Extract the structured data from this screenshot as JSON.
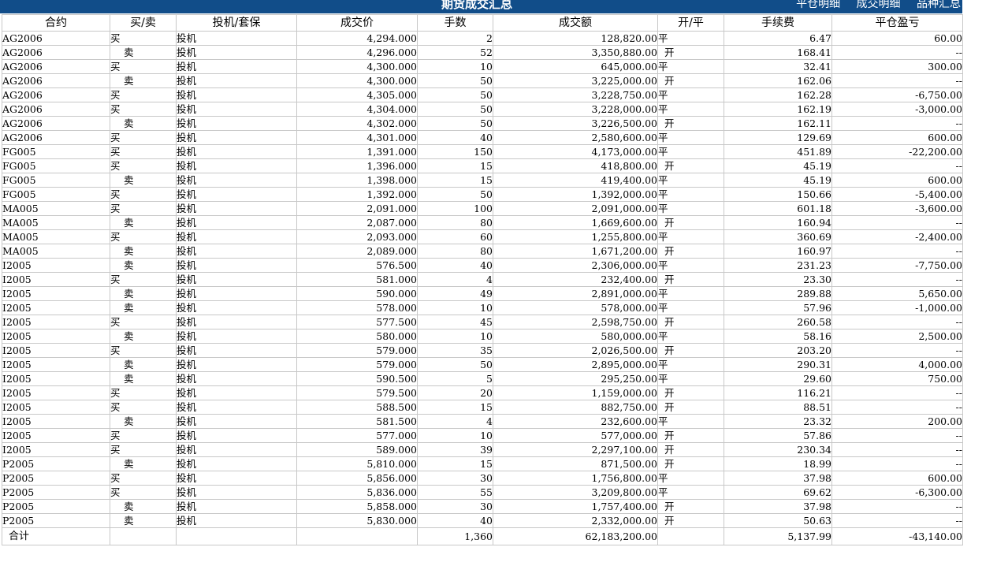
{
  "header": {
    "title": "期货成交汇总",
    "links": [
      "平仓明细",
      "成交明细",
      "品种汇总"
    ]
  },
  "columns": [
    "合约",
    "买/卖",
    "投机/套保",
    "成交价",
    "手数",
    "成交额",
    "开/平",
    "手续费",
    "平仓盈亏"
  ],
  "rows": [
    [
      "AG2006",
      "买",
      "投机",
      "4,294.000",
      "2",
      "128,820.00",
      "平",
      "6.47",
      "60.00"
    ],
    [
      "AG2006",
      "卖",
      "投机",
      "4,296.000",
      "52",
      "3,350,880.00",
      "开",
      "168.41",
      "--"
    ],
    [
      "AG2006",
      "买",
      "投机",
      "4,300.000",
      "10",
      "645,000.00",
      "平",
      "32.41",
      "300.00"
    ],
    [
      "AG2006",
      "卖",
      "投机",
      "4,300.000",
      "50",
      "3,225,000.00",
      "开",
      "162.06",
      "--"
    ],
    [
      "AG2006",
      "买",
      "投机",
      "4,305.000",
      "50",
      "3,228,750.00",
      "平",
      "162.28",
      "-6,750.00"
    ],
    [
      "AG2006",
      "买",
      "投机",
      "4,304.000",
      "50",
      "3,228,000.00",
      "平",
      "162.19",
      "-3,000.00"
    ],
    [
      "AG2006",
      "卖",
      "投机",
      "4,302.000",
      "50",
      "3,226,500.00",
      "开",
      "162.11",
      "--"
    ],
    [
      "AG2006",
      "买",
      "投机",
      "4,301.000",
      "40",
      "2,580,600.00",
      "平",
      "129.69",
      "600.00"
    ],
    [
      "FG005",
      "买",
      "投机",
      "1,391.000",
      "150",
      "4,173,000.00",
      "平",
      "451.89",
      "-22,200.00"
    ],
    [
      "FG005",
      "买",
      "投机",
      "1,396.000",
      "15",
      "418,800.00",
      "开",
      "45.19",
      "--"
    ],
    [
      "FG005",
      "卖",
      "投机",
      "1,398.000",
      "15",
      "419,400.00",
      "平",
      "45.19",
      "600.00"
    ],
    [
      "FG005",
      "买",
      "投机",
      "1,392.000",
      "50",
      "1,392,000.00",
      "平",
      "150.66",
      "-5,400.00"
    ],
    [
      "MA005",
      "买",
      "投机",
      "2,091.000",
      "100",
      "2,091,000.00",
      "平",
      "601.18",
      "-3,600.00"
    ],
    [
      "MA005",
      "卖",
      "投机",
      "2,087.000",
      "80",
      "1,669,600.00",
      "开",
      "160.94",
      "--"
    ],
    [
      "MA005",
      "买",
      "投机",
      "2,093.000",
      "60",
      "1,255,800.00",
      "平",
      "360.69",
      "-2,400.00"
    ],
    [
      "MA005",
      "卖",
      "投机",
      "2,089.000",
      "80",
      "1,671,200.00",
      "开",
      "160.97",
      "--"
    ],
    [
      "I2005",
      "卖",
      "投机",
      "576.500",
      "40",
      "2,306,000.00",
      "平",
      "231.23",
      "-7,750.00"
    ],
    [
      "I2005",
      "买",
      "投机",
      "581.000",
      "4",
      "232,400.00",
      "开",
      "23.30",
      "--"
    ],
    [
      "I2005",
      "卖",
      "投机",
      "590.000",
      "49",
      "2,891,000.00",
      "平",
      "289.88",
      "5,650.00"
    ],
    [
      "I2005",
      "卖",
      "投机",
      "578.000",
      "10",
      "578,000.00",
      "平",
      "57.96",
      "-1,000.00"
    ],
    [
      "I2005",
      "买",
      "投机",
      "577.500",
      "45",
      "2,598,750.00",
      "开",
      "260.58",
      "--"
    ],
    [
      "I2005",
      "卖",
      "投机",
      "580.000",
      "10",
      "580,000.00",
      "平",
      "58.16",
      "2,500.00"
    ],
    [
      "I2005",
      "买",
      "投机",
      "579.000",
      "35",
      "2,026,500.00",
      "开",
      "203.20",
      "--"
    ],
    [
      "I2005",
      "卖",
      "投机",
      "579.000",
      "50",
      "2,895,000.00",
      "平",
      "290.31",
      "4,000.00"
    ],
    [
      "I2005",
      "卖",
      "投机",
      "590.500",
      "5",
      "295,250.00",
      "平",
      "29.60",
      "750.00"
    ],
    [
      "I2005",
      "买",
      "投机",
      "579.500",
      "20",
      "1,159,000.00",
      "开",
      "116.21",
      "--"
    ],
    [
      "I2005",
      "买",
      "投机",
      "588.500",
      "15",
      "882,750.00",
      "开",
      "88.51",
      "--"
    ],
    [
      "I2005",
      "卖",
      "投机",
      "581.500",
      "4",
      "232,600.00",
      "平",
      "23.32",
      "200.00"
    ],
    [
      "I2005",
      "买",
      "投机",
      "577.000",
      "10",
      "577,000.00",
      "开",
      "57.86",
      "--"
    ],
    [
      "I2005",
      "买",
      "投机",
      "589.000",
      "39",
      "2,297,100.00",
      "开",
      "230.34",
      "--"
    ],
    [
      "P2005",
      "卖",
      "投机",
      "5,810.000",
      "15",
      "871,500.00",
      "开",
      "18.99",
      "--"
    ],
    [
      "P2005",
      "买",
      "投机",
      "5,856.000",
      "30",
      "1,756,800.00",
      "平",
      "37.98",
      "600.00"
    ],
    [
      "P2005",
      "买",
      "投机",
      "5,836.000",
      "55",
      "3,209,800.00",
      "平",
      "69.62",
      "-6,300.00"
    ],
    [
      "P2005",
      "卖",
      "投机",
      "5,858.000",
      "30",
      "1,757,400.00",
      "开",
      "37.98",
      "--"
    ],
    [
      "P2005",
      "卖",
      "投机",
      "5,830.000",
      "40",
      "2,332,000.00",
      "开",
      "50.63",
      "--"
    ]
  ],
  "total": {
    "label": "合计",
    "lots": "1,360",
    "amount": "62,183,200.00",
    "fee": "5,137.99",
    "pnl": "-43,140.00"
  },
  "colors": {
    "header_bg": "#114d89",
    "border": "#c8c8c8"
  }
}
